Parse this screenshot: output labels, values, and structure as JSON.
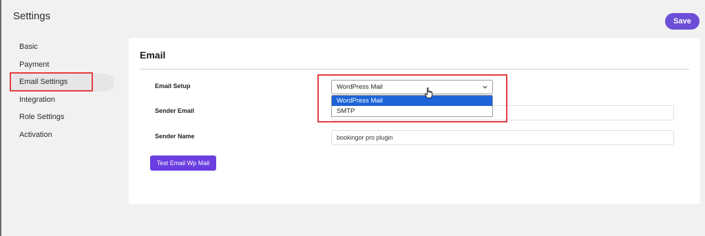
{
  "header": {
    "title": "Settings",
    "save_label": "Save"
  },
  "sidebar": {
    "items": [
      {
        "label": "Basic"
      },
      {
        "label": "Payment"
      },
      {
        "label": "Email Settings",
        "active": true
      },
      {
        "label": "Integration"
      },
      {
        "label": "Role Settings"
      },
      {
        "label": "Activation"
      }
    ]
  },
  "panel": {
    "title": "Email",
    "email_setup": {
      "label": "Email Setup",
      "value": "WordPress Mail",
      "options": [
        "WordPress Mail",
        "SMTP"
      ]
    },
    "sender_email": {
      "label": "Sender Email",
      "value": ""
    },
    "sender_name": {
      "label": "Sender Name",
      "value": "bookingor pro plugin"
    },
    "test_button_label": "Test Email Wp Mail"
  },
  "colors": {
    "accent": "#6c4fd6",
    "highlight_box": "#e23b3b",
    "selected_option": "#1d64d8"
  }
}
